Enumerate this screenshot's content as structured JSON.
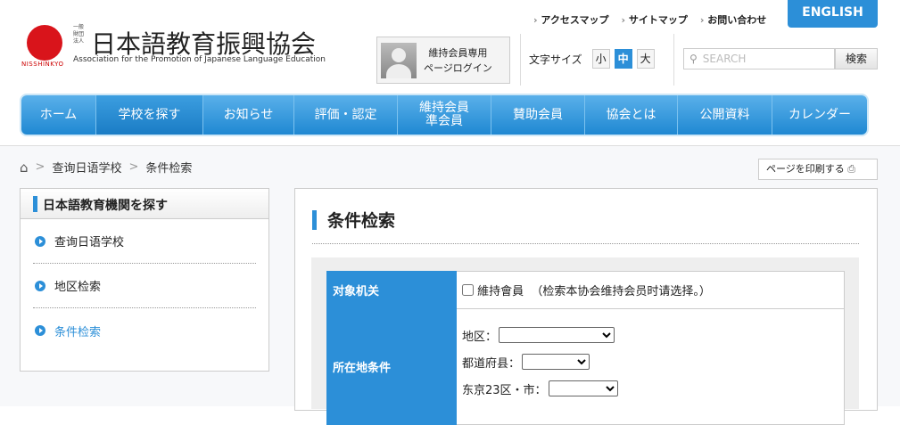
{
  "logo": {
    "small": "一般財団法人",
    "title": "日本語教育振興協会",
    "brand": "NISSHINKYO",
    "english": "Association for the Promotion of Japanese Language Education"
  },
  "toplinks": [
    "アクセスマップ",
    "サイトマップ",
    "お問い合わせ"
  ],
  "english_button": "ENGLISH",
  "login": {
    "line1": "維持会員専用",
    "line2": "ページログイン"
  },
  "font_size": {
    "label": "文字サイズ",
    "small": "小",
    "medium": "中",
    "large": "大"
  },
  "search": {
    "placeholder": "SEARCH",
    "button": "検索"
  },
  "nav": [
    "ホーム",
    "学校を探す",
    "お知らせ",
    "評価・認定",
    "維持会員\n準会員",
    "賛助会員",
    "協会とは",
    "公開資料",
    "カレンダー"
  ],
  "breadcrumb": [
    "查询日语学校",
    "条件检索"
  ],
  "print_button": "ページを印刷する",
  "sidebar": {
    "title": "日本語教育機関を探す",
    "items": [
      "查询日语学校",
      "地区检索",
      "条件检索"
    ]
  },
  "main": {
    "title": "条件检索",
    "rows": {
      "target_label": "对象机关",
      "member_checkbox": "維持會員",
      "member_note": "（检索本协会维持会员时请选择。）",
      "location_label": "所在地条件",
      "region": "地区：",
      "prefecture": "都道府县：",
      "ward": "东京23区・市："
    }
  },
  "colors": {
    "accent": "#2c8fd8"
  }
}
